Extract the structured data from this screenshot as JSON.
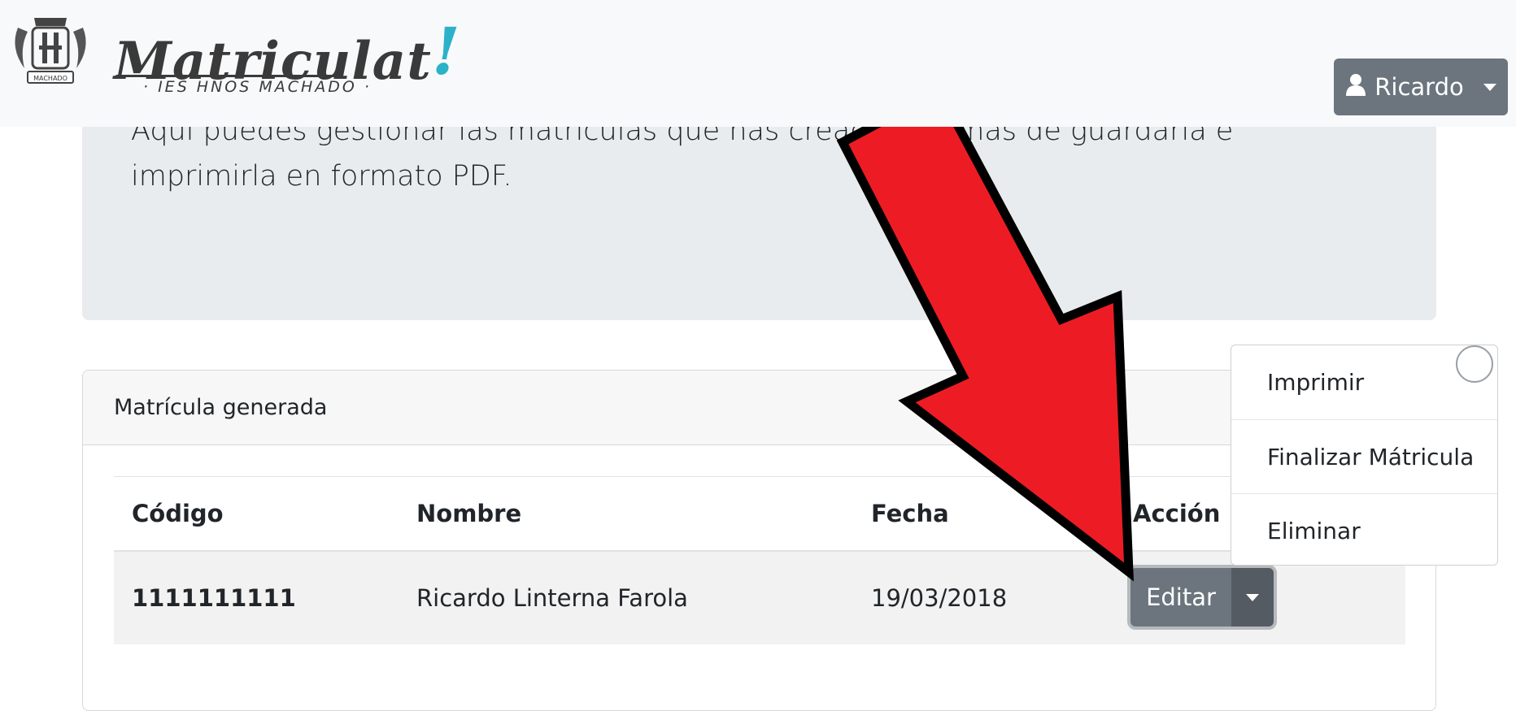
{
  "brand": {
    "name": "Matriculat",
    "mark": "!",
    "subtitle": "· IES HNOS MACHADO ·",
    "crest_text": "MACHADO"
  },
  "user_menu": {
    "label": "Ricardo",
    "icon": "user-icon"
  },
  "jumbotron": {
    "text": "Aquí puedes gestionar las matrículas que has creado, además de guardarla e imprimirla en formato PDF."
  },
  "card": {
    "title": "Matrícula generada",
    "columns": [
      "Código",
      "Nombre",
      "Fecha",
      "Acción"
    ],
    "rows": [
      {
        "codigo": "1111111111",
        "nombre": "Ricardo Linterna Farola",
        "fecha": "19/03/2018"
      }
    ]
  },
  "action": {
    "edit_label": "Editar",
    "toggle_icon": "caret-down-icon"
  },
  "dropdown": {
    "items": [
      "Imprimir",
      "Finalizar Mátricula",
      "Eliminar"
    ]
  },
  "annotation": {
    "arrow_color": "#ed1c24",
    "outline_color": "#000000"
  },
  "colors": {
    "navbar_bg": "#f8f9fa",
    "jumbotron_bg": "#e9ecef",
    "button_secondary": "#6c757d",
    "accent_teal": "#2bb2c9"
  }
}
